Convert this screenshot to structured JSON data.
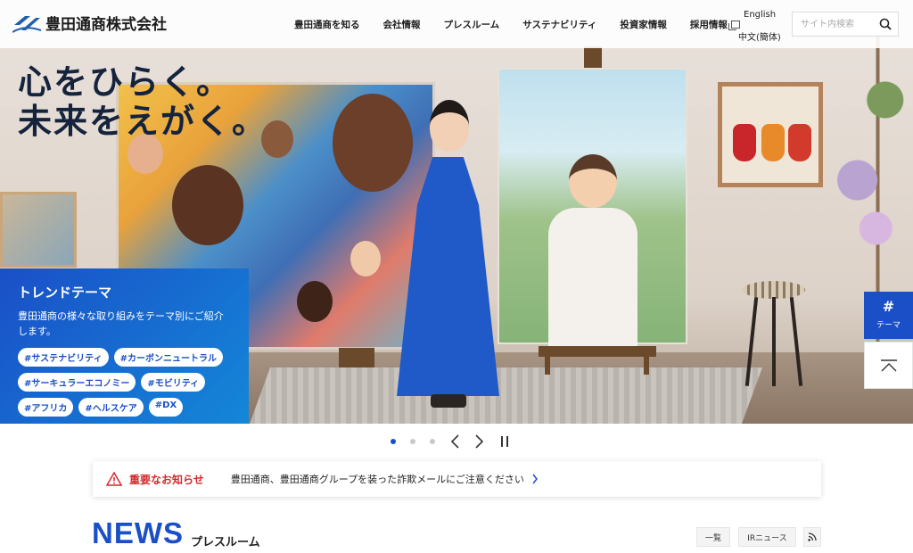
{
  "header": {
    "logo_text": "豊田通商株式会社",
    "nav": [
      {
        "label": "豊田通商を知る"
      },
      {
        "label": "会社情報"
      },
      {
        "label": "プレスルーム"
      },
      {
        "label": "サステナビリティ"
      },
      {
        "label": "投資家情報"
      },
      {
        "label": "採用情報",
        "external": true
      }
    ],
    "lang_en": "English",
    "lang_zh": "中文(簡体)",
    "search_placeholder": "サイト内検索"
  },
  "hero": {
    "tagline_line1": "心をひらく。",
    "tagline_line2": "未来をえがく。"
  },
  "trend": {
    "title": "トレンドテーマ",
    "description": "豊田通商の様々な取り組みをテーマ別にご紹介します。",
    "tags": [
      "#サステナビリティ",
      "#カーボンニュートラル",
      "#サーキュラーエコノミー",
      "#モビリティ",
      "#アフリカ",
      "#ヘルスケア",
      "#DX"
    ]
  },
  "side": {
    "theme_hash": "#",
    "theme_label": "テーマ"
  },
  "carousel": {
    "slide_count": 3,
    "active_index": 0
  },
  "notice": {
    "label": "重要なお知らせ",
    "text": "豊田通商、豊田通商グループを装った詐欺メールにご注意ください"
  },
  "news": {
    "title_en": "NEWS",
    "title_ja": "プレスルーム",
    "btn_list": "一覧",
    "btn_ir": "IRニュース"
  },
  "colors": {
    "accent": "#1a4fc7",
    "alert": "#d22a2a"
  }
}
